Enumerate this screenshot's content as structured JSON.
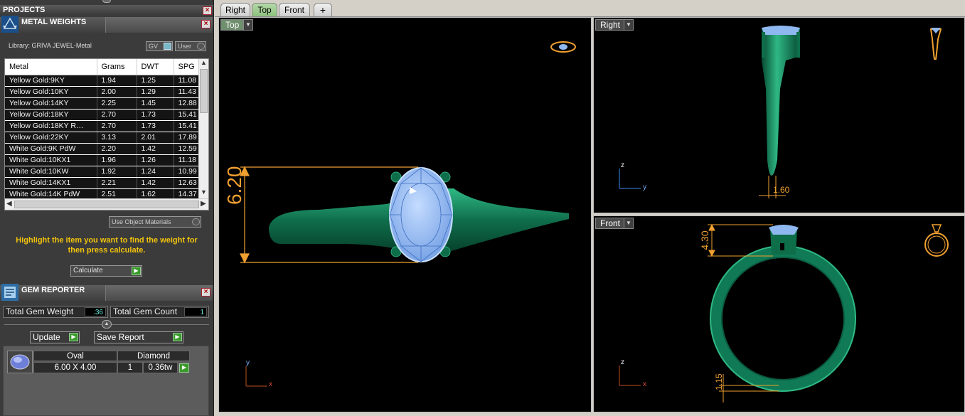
{
  "projects": {
    "title": "PROJECTS"
  },
  "metal_weights": {
    "title": "METAL WEIGHTS",
    "library": "Library: GRIVA JEWEL-Metal",
    "gv_label": "GV",
    "user_label": "User",
    "columns": [
      "Metal",
      "Grams",
      "DWT",
      "SPG"
    ],
    "rows": [
      [
        "Yellow Gold:9KY",
        "1.94",
        "1.25",
        "11.08"
      ],
      [
        "Yellow Gold:10KY",
        "2.00",
        "1.29",
        "11.43"
      ],
      [
        "Yellow Gold:14KY",
        "2.25",
        "1.45",
        "12.88"
      ],
      [
        "Yellow Gold:18KY",
        "2.70",
        "1.73",
        "15.41"
      ],
      [
        "Yellow Gold:18KY R…",
        "2.70",
        "1.73",
        "15.41"
      ],
      [
        "Yellow Gold:22KY",
        "3.13",
        "2.01",
        "17.89"
      ],
      [
        "White Gold:9K PdW",
        "2.20",
        "1.42",
        "12.59"
      ],
      [
        "White Gold:10KX1",
        "1.96",
        "1.26",
        "11.18"
      ],
      [
        "White Gold:10KW",
        "1.92",
        "1.24",
        "10.99"
      ],
      [
        "White Gold:14KX1",
        "2.21",
        "1.42",
        "12.63"
      ],
      [
        "White Gold:14K PdW",
        "2.51",
        "1.62",
        "14.37"
      ]
    ],
    "use_object_materials": "Use Object Materials",
    "hint": "Highlight the item you want to find the weight for then press calculate.",
    "calculate": "Calculate"
  },
  "gem_reporter": {
    "title": "GEM REPORTER",
    "total_weight_label": "Total Gem Weight",
    "total_weight": ".36",
    "total_count_label": "Total Gem Count",
    "total_count": "1",
    "update": "Update",
    "save_report": "Save Report",
    "gem": {
      "shape": "Oval",
      "size": "6.00 X 4.00",
      "type": "Diamond",
      "qty": "1",
      "weight": "0.36tw"
    }
  },
  "tabs": [
    "Right",
    "Top",
    "Front",
    "+"
  ],
  "viewports": {
    "top": {
      "label": "Top",
      "dimension": "6.20",
      "axis_y": "y",
      "axis_x": "x"
    },
    "right": {
      "label": "Right",
      "dimension": "1.60",
      "axis_z": "z",
      "axis_y": "y"
    },
    "front": {
      "label": "Front",
      "dimension_top": "4.30",
      "dimension_bottom": "1.15",
      "axis_z": "z",
      "axis_x": "x"
    }
  },
  "colors": {
    "metal": "#0e7a55",
    "metal_light": "#2fb884",
    "gem": "#8fb8f0",
    "dim": "#f0a030",
    "panel_bg": "#3b3b3b",
    "hint": "#f3c40b"
  }
}
